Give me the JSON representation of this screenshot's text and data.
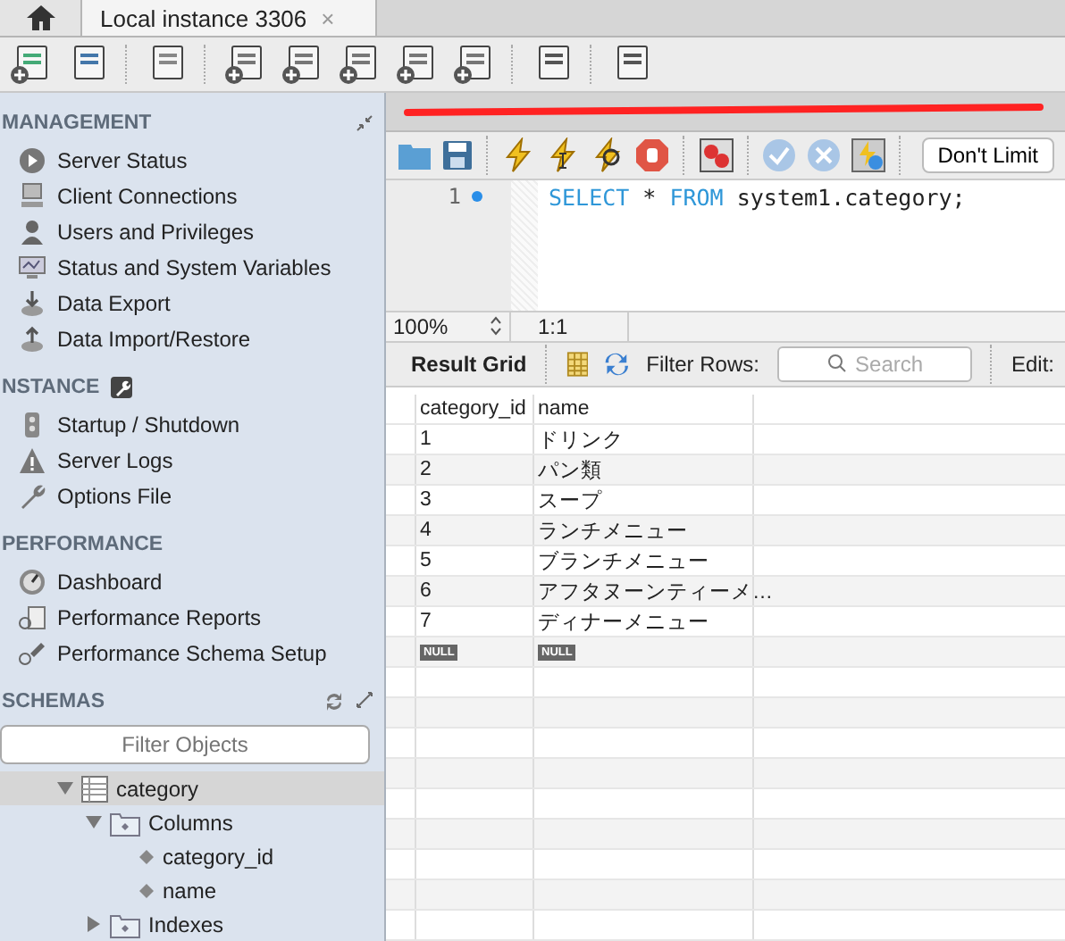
{
  "window_tab": {
    "title": "Local instance 3306",
    "close": "×"
  },
  "sidebar": {
    "sections": [
      {
        "title": "MANAGEMENT",
        "items": [
          "Server Status",
          "Client Connections",
          "Users and Privileges",
          "Status and System Variables",
          "Data Export",
          "Data Import/Restore"
        ]
      },
      {
        "title": "NSTANCE",
        "items": [
          "Startup / Shutdown",
          "Server Logs",
          "Options File"
        ]
      },
      {
        "title": "PERFORMANCE",
        "items": [
          "Dashboard",
          "Performance Reports",
          "Performance Schema Setup"
        ]
      }
    ],
    "schemas": {
      "title": "SCHEMAS",
      "filter_placeholder": "Filter Objects",
      "tree": [
        {
          "label": "category",
          "kind": "table",
          "expanded": true,
          "selected": true,
          "children": [
            {
              "label": "Columns",
              "kind": "folder",
              "expanded": true,
              "selected": false,
              "children": [
                {
                  "label": "category_id",
                  "kind": "column",
                  "selected": false
                },
                {
                  "label": "name",
                  "kind": "column",
                  "selected": false
                }
              ]
            },
            {
              "label": "Indexes",
              "kind": "folder",
              "expanded": false,
              "selected": false
            }
          ]
        }
      ]
    }
  },
  "query_toolbar": {
    "limit": "Don't Limit"
  },
  "editor": {
    "lines": [
      {
        "number": "1",
        "tokens": [
          {
            "text": "SELECT",
            "kind": "keyword"
          },
          {
            "text": " * ",
            "kind": "plain"
          },
          {
            "text": "FROM",
            "kind": "keyword"
          },
          {
            "text": " system1.category;",
            "kind": "plain"
          }
        ]
      }
    ]
  },
  "editor_status": {
    "zoom": "100%",
    "position": "1:1"
  },
  "result_toolbar": {
    "title": "Result Grid",
    "filter_label": "Filter Rows:",
    "search_placeholder": "Search",
    "edit_label": "Edit:"
  },
  "table": {
    "columns": [
      "category_id",
      "name"
    ],
    "rows": [
      {
        "kind": "data",
        "cells": [
          "1",
          "ドリンク"
        ]
      },
      {
        "kind": "data",
        "cells": [
          "2",
          "パン類"
        ]
      },
      {
        "kind": "data",
        "cells": [
          "3",
          "スープ"
        ]
      },
      {
        "kind": "data",
        "cells": [
          "4",
          "ランチメニュー"
        ]
      },
      {
        "kind": "data",
        "cells": [
          "5",
          "ブランチメニュー"
        ]
      },
      {
        "kind": "data",
        "cells": [
          "6",
          "アフタヌーンティーメ…"
        ]
      },
      {
        "kind": "data",
        "cells": [
          "7",
          "ディナーメニュー"
        ]
      },
      {
        "kind": "null",
        "cells": [
          "NULL",
          "NULL"
        ]
      }
    ]
  }
}
